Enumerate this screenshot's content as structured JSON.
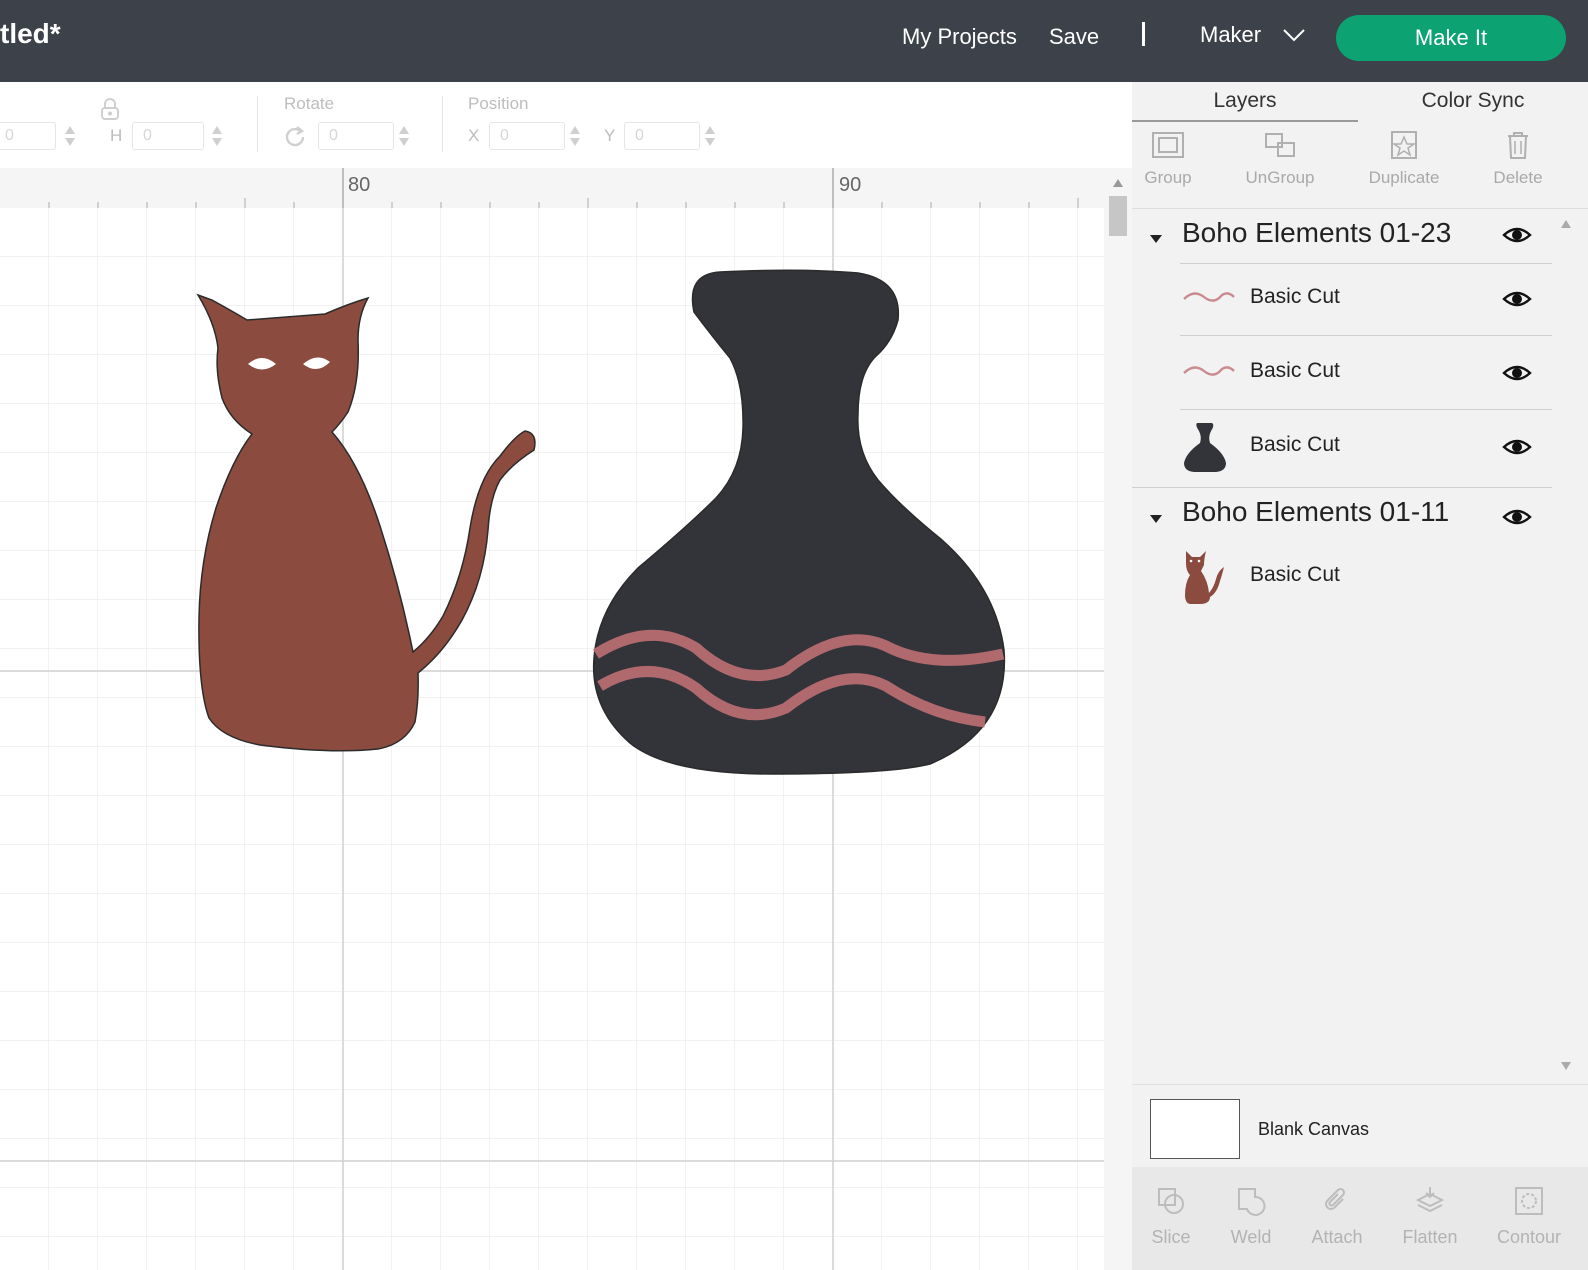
{
  "header": {
    "title": "tled*",
    "links": {
      "my_projects": "My Projects",
      "save": "Save"
    },
    "separator": "|",
    "machine": "Maker",
    "make_it": "Make It"
  },
  "edit_toolbar": {
    "w_value": "0",
    "h_label": "H",
    "h_value": "0",
    "rotate_label": "Rotate",
    "rotate_value": "0",
    "position_label": "Position",
    "x_label": "X",
    "x_value": "0",
    "y_label": "Y",
    "y_value": "0"
  },
  "ruler": {
    "marks": [
      "80",
      "90"
    ]
  },
  "canvas": {
    "colors": {
      "cat": "#8c4b3f",
      "vase": "#33333a",
      "wave": "#b06a6e",
      "outline": "#2b2b2b"
    }
  },
  "panel": {
    "tabs": [
      "Layers",
      "Color Sync"
    ],
    "tools": [
      "Group",
      "UnGroup",
      "Duplicate",
      "Delete"
    ],
    "groups": [
      {
        "title": "Boho Elements 01-23",
        "layers": [
          "Basic Cut",
          "Basic Cut",
          "Basic Cut"
        ]
      },
      {
        "title": "Boho Elements 01-11",
        "layers": [
          "Basic Cut"
        ]
      }
    ],
    "canvas_label": "Blank Canvas",
    "bottom_tools": [
      "Slice",
      "Weld",
      "Attach",
      "Flatten",
      "Contour"
    ]
  }
}
